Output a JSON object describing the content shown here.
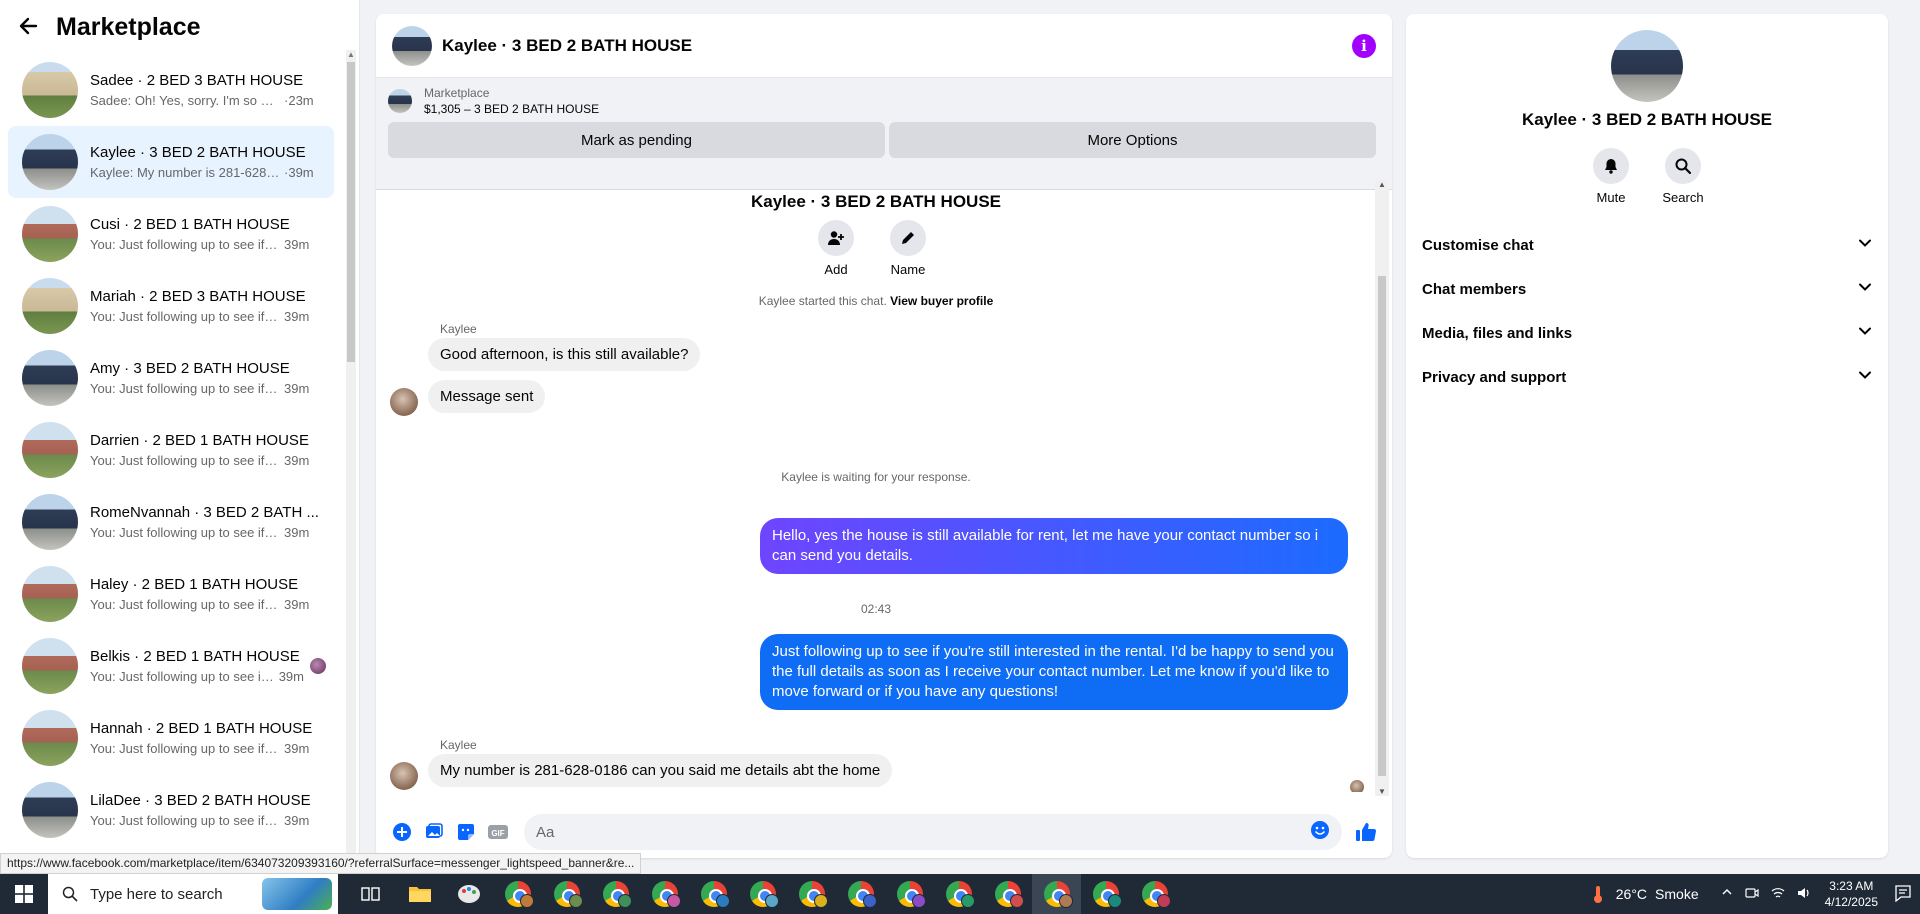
{
  "sidebar": {
    "title": "Marketplace",
    "conversations": [
      {
        "title": "Sadee · 2 BED 3 BATH HOUSE",
        "snippet": "Sadee: Oh! Yes, sorry. I'm so busy...",
        "time": "23m",
        "thumb": "house-beige"
      },
      {
        "title": "Kaylee · 3 BED 2 BATH HOUSE",
        "snippet": "Kaylee: My number is 281-628-0...",
        "time": "39m",
        "thumb": "house-navy"
      },
      {
        "title": "Cusi · 2 BED 1 BATH HOUSE",
        "snippet": "You: Just following up to see if yo...",
        "time": "39m",
        "thumb": "house-brick"
      },
      {
        "title": "Mariah · 2 BED 3 BATH HOUSE",
        "snippet": "You: Just following up to see if yo...",
        "time": "39m",
        "thumb": "house-beige"
      },
      {
        "title": "Amy · 3 BED 2 BATH HOUSE",
        "snippet": "You: Just following up to see if yo...",
        "time": "39m",
        "thumb": "house-navy"
      },
      {
        "title": "Darrien · 2 BED 1 BATH HOUSE",
        "snippet": "You: Just following up to see if yo...",
        "time": "39m",
        "thumb": "house-brick"
      },
      {
        "title": "RomeNvannah · 3 BED 2 BATH ...",
        "snippet": "You: Just following up to see if yo...",
        "time": "39m",
        "thumb": "house-navy"
      },
      {
        "title": "Haley · 2 BED 1 BATH HOUSE",
        "snippet": "You: Just following up to see if yo...",
        "time": "39m",
        "thumb": "house-brick"
      },
      {
        "title": "Belkis · 2 BED 1 BATH HOUSE",
        "snippet": "You: Just following up to see if...",
        "time": "39m",
        "thumb": "house-brick"
      },
      {
        "title": "Hannah · 2 BED 1 BATH HOUSE",
        "snippet": "You: Just following up to see if yo...",
        "time": "39m",
        "thumb": "house-brick"
      },
      {
        "title": "LilaDee · 3 BED 2 BATH HOUSE",
        "snippet": "You: Just following up to see if yo...",
        "time": "39m",
        "thumb": "house-navy"
      }
    ]
  },
  "status_url": "https://www.facebook.com/marketplace/item/634073209393160/?referralSurface=messenger_lightspeed_banner&re...",
  "chat": {
    "header_title": "Kaylee · 3 BED 2 BATH HOUSE",
    "listing_label": "Marketplace",
    "listing_title": "$1,305 – 3 BED 2 BATH HOUSE",
    "mark_pending": "Mark as pending",
    "more_options": "More Options",
    "convo_title": "Kaylee · 3 BED 2 BATH HOUSE",
    "add_label": "Add",
    "name_label": "Name",
    "started_text": "Kaylee started this chat.",
    "view_buyer": "View buyer profile",
    "sender1": "Kaylee",
    "msg_in_1": "Good afternoon, is this still available?",
    "msg_in_2": "Message sent",
    "waiting_text": "Kaylee is waiting for your response.",
    "msg_out_1": "Hello, yes the house is still available for rent, let me have your contact number so i can send you details.",
    "timestamp": "02:43",
    "msg_out_2": "Just following up to see if you're still interested in the rental. I'd be happy to send you the full details as soon as I receive your contact number. Let me know if you'd like to move forward or if you have any questions!",
    "sender2": "Kaylee",
    "msg_in_3": "My number is 281-628-0186 can you said me details abt the home",
    "composer_placeholder": "Aa"
  },
  "info_panel": {
    "name": "Kaylee · 3 BED 2 BATH HOUSE",
    "mute_label": "Mute",
    "search_label": "Search",
    "sections": [
      "Customise chat",
      "Chat members",
      "Media, files and links",
      "Privacy and support"
    ]
  },
  "taskbar": {
    "search_placeholder": "Type here to search",
    "temperature": "26°C",
    "weather": "Smoke",
    "time": "3:23 AM",
    "date": "4/12/2025"
  },
  "colors": {
    "accent": "#0866ff",
    "info_icon": "#a100ff",
    "outgoing_gradient_start": "#6f45ff",
    "outgoing_gradient_end": "#1c6bff"
  }
}
